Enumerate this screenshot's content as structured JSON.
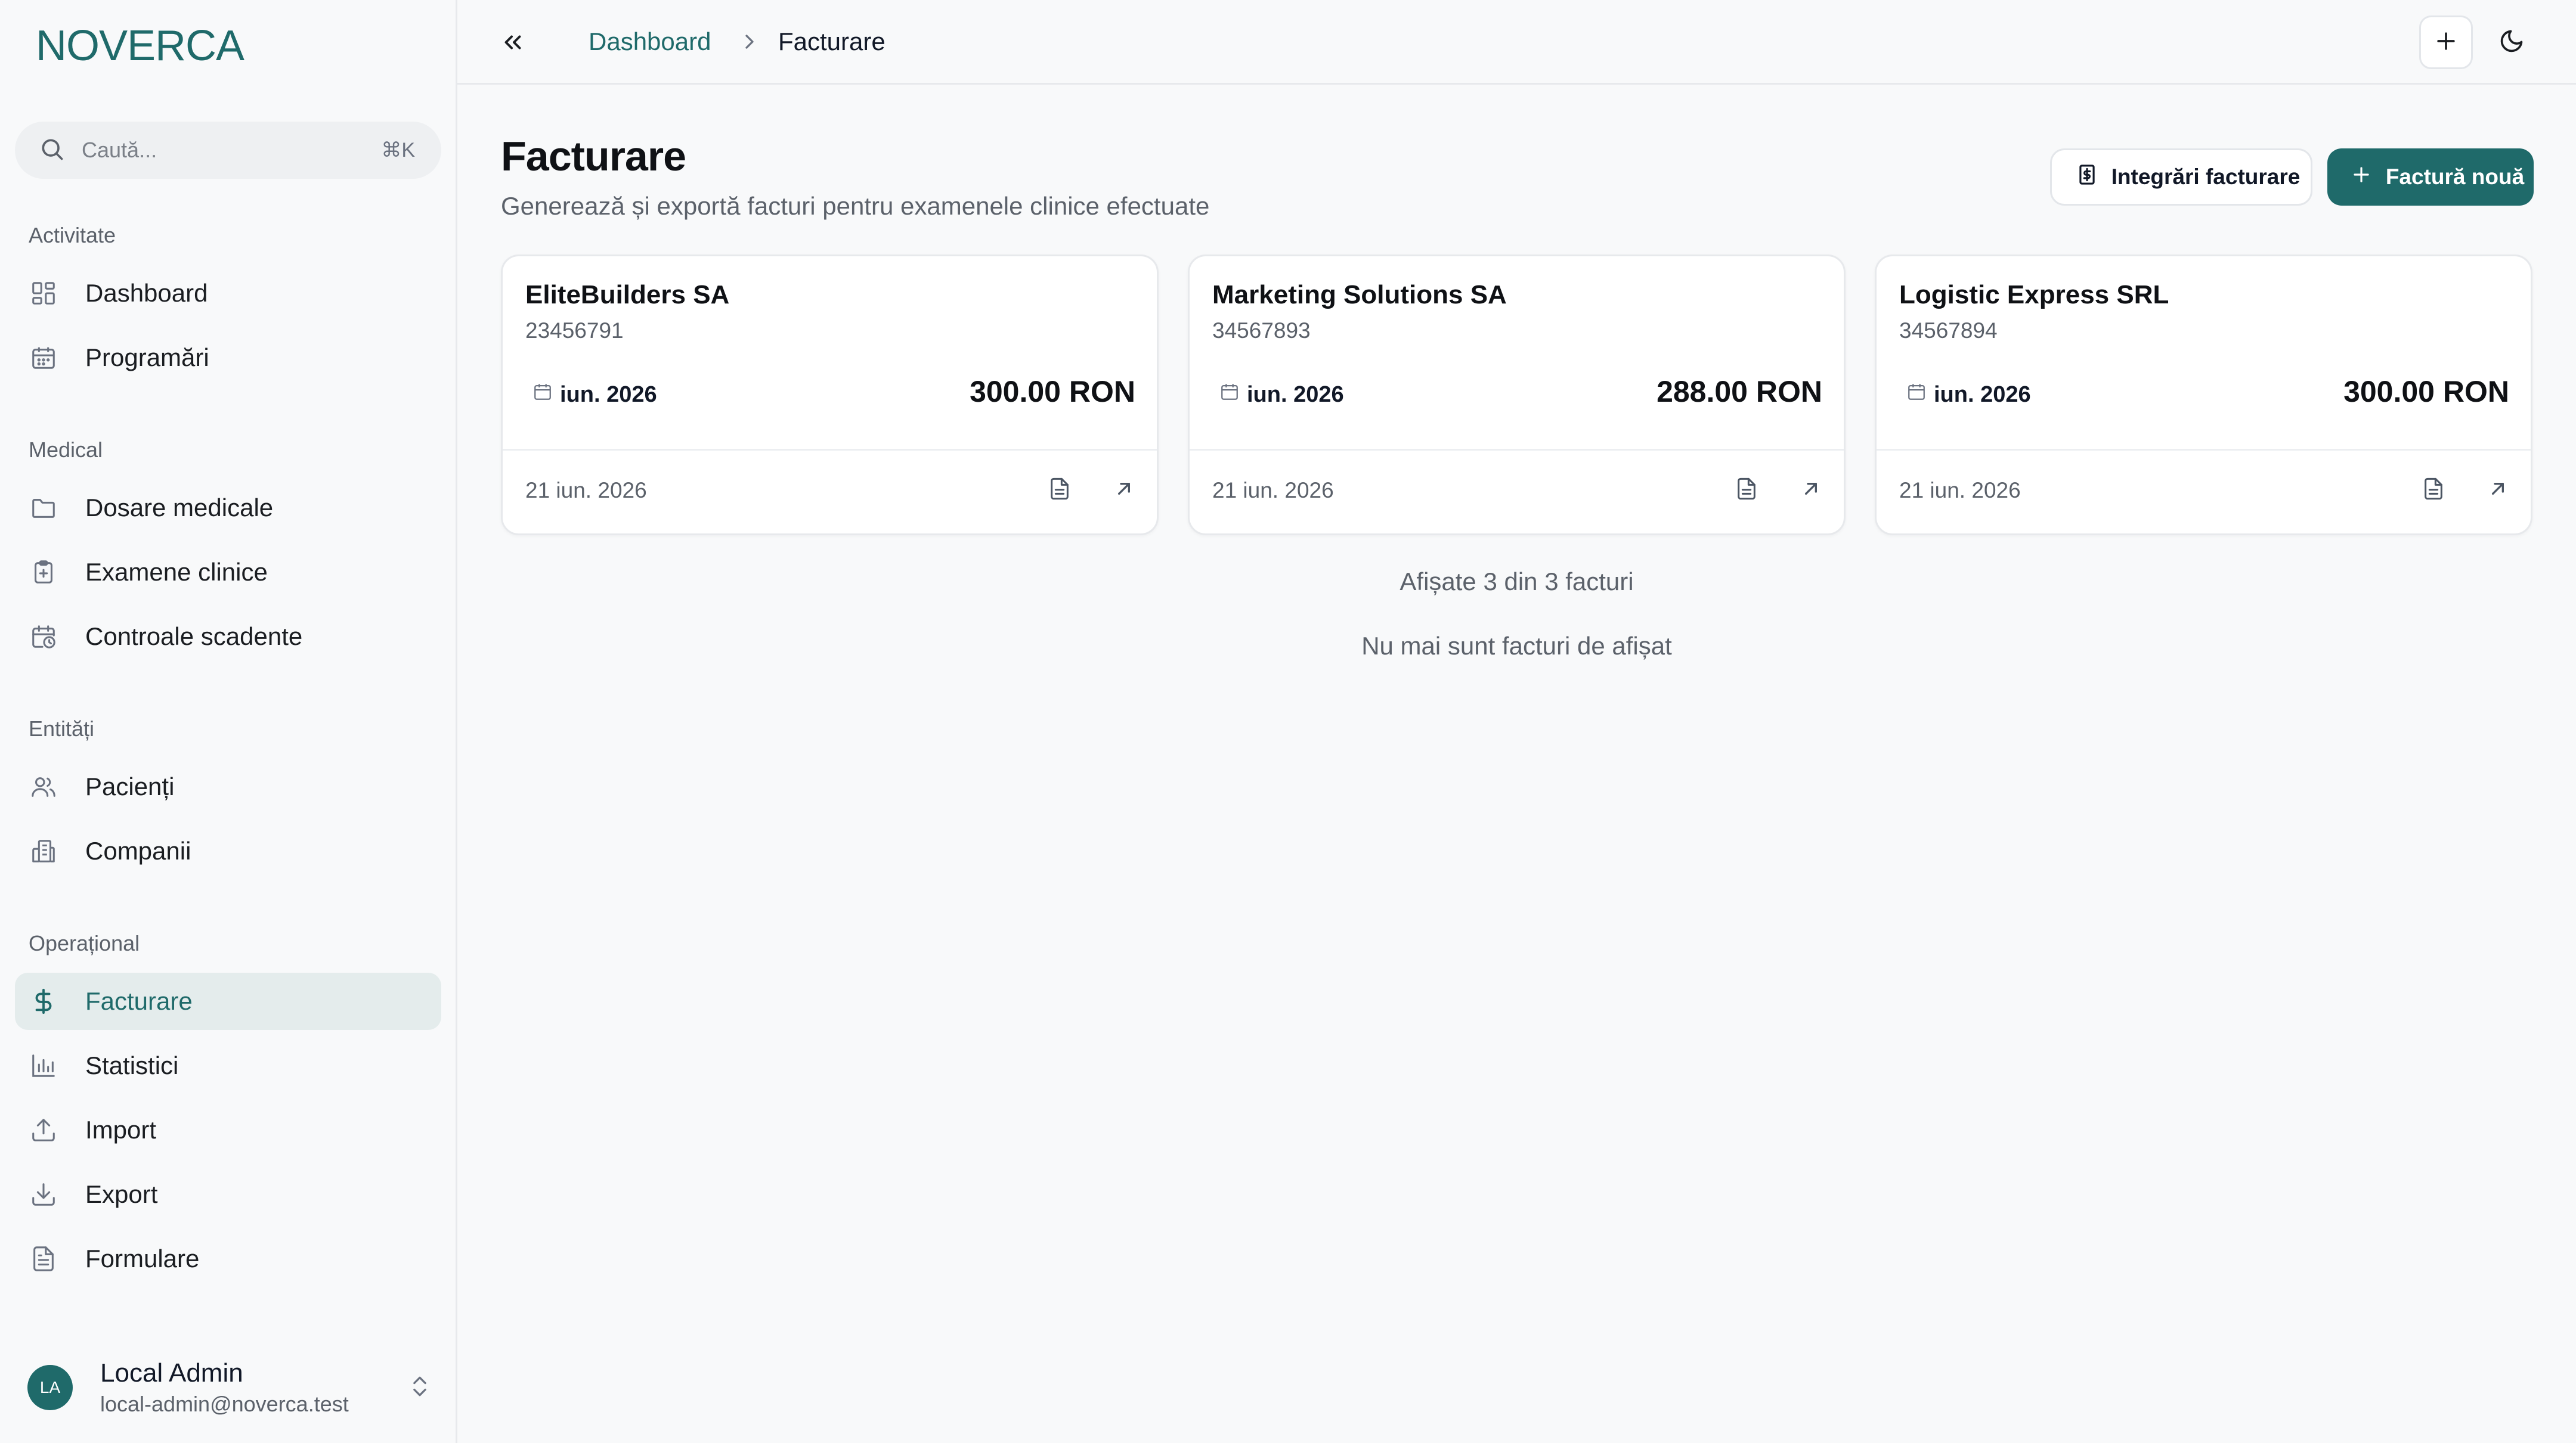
{
  "app": {
    "logo": "NOVERCA"
  },
  "search": {
    "placeholder": "Caută...",
    "shortcut": "⌘K"
  },
  "sidebar": {
    "sections": [
      {
        "label": "Activitate",
        "items": [
          {
            "label": "Dashboard",
            "icon": "dashboard-icon"
          },
          {
            "label": "Programări",
            "icon": "calendar-icon"
          }
        ]
      },
      {
        "label": "Medical",
        "items": [
          {
            "label": "Dosare medicale",
            "icon": "folder-icon"
          },
          {
            "label": "Examene clinice",
            "icon": "clipboard-plus-icon"
          },
          {
            "label": "Controale scadente",
            "icon": "calendar-clock-icon"
          }
        ]
      },
      {
        "label": "Entități",
        "items": [
          {
            "label": "Pacienți",
            "icon": "users-icon"
          },
          {
            "label": "Companii",
            "icon": "building-icon"
          }
        ]
      },
      {
        "label": "Operațional",
        "items": [
          {
            "label": "Facturare",
            "icon": "dollar-icon",
            "active": true
          },
          {
            "label": "Statistici",
            "icon": "bar-chart-icon"
          },
          {
            "label": "Import",
            "icon": "upload-icon"
          },
          {
            "label": "Export",
            "icon": "download-icon"
          },
          {
            "label": "Formulare",
            "icon": "file-text-icon"
          }
        ]
      }
    ]
  },
  "user": {
    "initials": "LA",
    "name": "Local Admin",
    "email": "local-admin@noverca.test"
  },
  "breadcrumb": {
    "home": "Dashboard",
    "current": "Facturare"
  },
  "page": {
    "title": "Facturare",
    "subtitle": "Generează și exportă facturi pentru examenele clinice efectuate",
    "integrations_button": "Integrări facturare",
    "new_invoice_button": "Factură nouă"
  },
  "invoices": [
    {
      "company": "EliteBuilders SA",
      "code": "23456791",
      "period": "iun. 2026",
      "amount": "300.00 RON",
      "date": "21 iun. 2026"
    },
    {
      "company": "Marketing Solutions SA",
      "code": "34567893",
      "period": "iun. 2026",
      "amount": "288.00 RON",
      "date": "21 iun. 2026"
    },
    {
      "company": "Logistic Express SRL",
      "code": "34567894",
      "period": "iun. 2026",
      "amount": "300.00 RON",
      "date": "21 iun. 2026"
    }
  ],
  "footer": {
    "shown": "Afișate 3 din 3 facturi",
    "no_more": "Nu mai sunt facturi de afișat"
  },
  "colors": {
    "accent": "#1f6a6a",
    "active_bg": "#e4ecec",
    "background": "#f8f9fa"
  }
}
